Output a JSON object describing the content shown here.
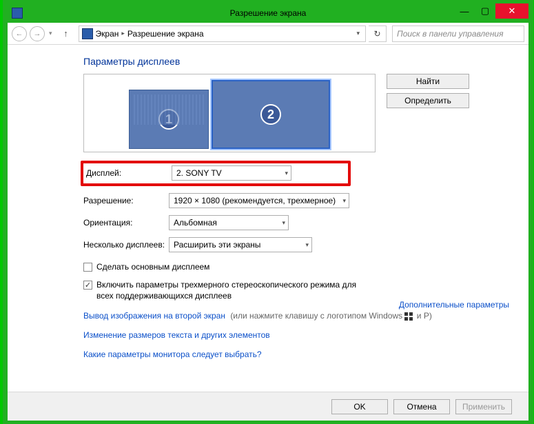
{
  "window": {
    "title": "Разрешение экрана",
    "minimize_icon": "—",
    "maximize_icon": "▢",
    "close_icon": "✕"
  },
  "nav": {
    "back_icon": "←",
    "forward_icon": "→",
    "dropdown_icon": "▾",
    "up_icon": "↑",
    "refresh_icon": "↻",
    "addr_dropdown_icon": "▾",
    "breadcrumb_sep": "▸",
    "crumb1": "Экран",
    "crumb2": "Разрешение экрана",
    "search_placeholder": "Поиск в панели управления"
  },
  "section": {
    "title": "Параметры дисплеев",
    "monitor1_num": "1",
    "monitor2_num": "2",
    "find_button": "Найти",
    "identify_button": "Определить"
  },
  "form": {
    "display_label": "Дисплей:",
    "display_value": "2. SONY TV",
    "resolution_label": "Разрешение:",
    "resolution_value": "1920 × 1080 (рекомендуется, трехмерное)",
    "orientation_label": "Ориентация:",
    "orientation_value": "Альбомная",
    "multiple_label": "Несколько дисплеев:",
    "multiple_value": "Расширить эти экраны"
  },
  "checks": {
    "make_primary": "Сделать основным дисплеем",
    "stereo": "Включить параметры трехмерного стереоскопического режима для всех поддерживающихся дисплеев",
    "checkmark": "✓"
  },
  "links": {
    "advanced": "Дополнительные параметры",
    "project": "Вывод изображения на второй экран",
    "project_hint": "(или нажмите клавишу с логотипом Windows",
    "project_hint_tail": "и P)",
    "text_size": "Изменение размеров текста и других элементов",
    "which_settings": "Какие параметры монитора следует выбрать?"
  },
  "footer": {
    "ok": "OK",
    "cancel": "Отмена",
    "apply": "Применить"
  }
}
